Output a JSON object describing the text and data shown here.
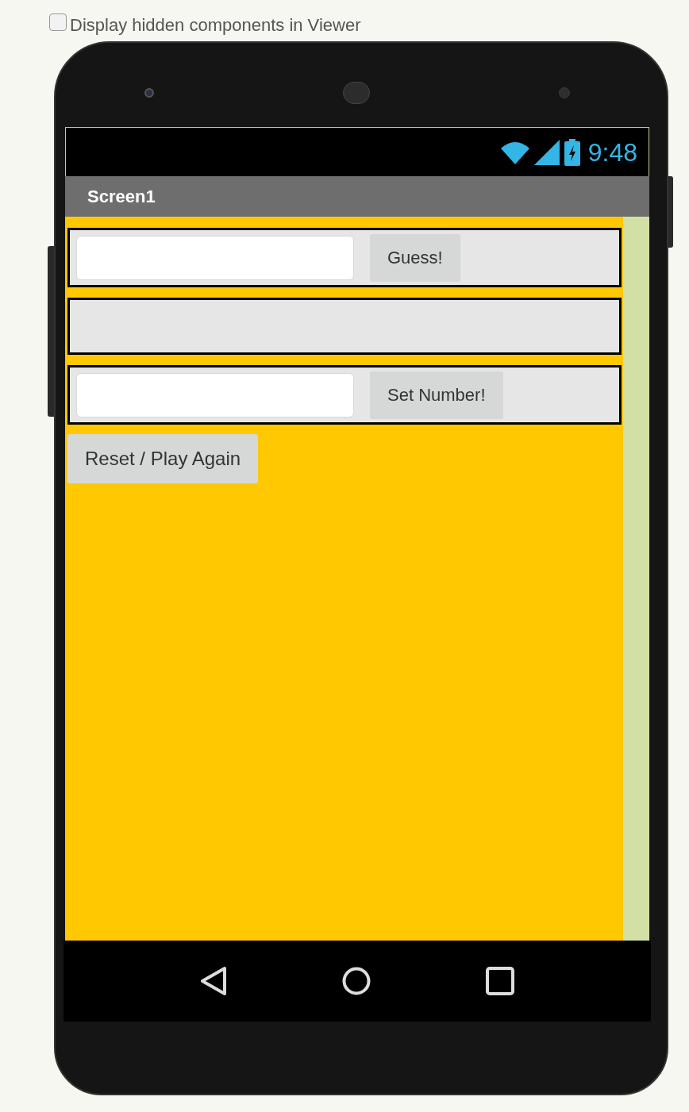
{
  "hidden_components_checkbox": {
    "label": "Display hidden components in Viewer",
    "checked": false
  },
  "status_bar": {
    "time": "9:48"
  },
  "screen": {
    "title": "Screen1"
  },
  "arrangements": [
    {
      "kind": "input_with_button",
      "button": "Guess!"
    },
    {
      "kind": "empty"
    },
    {
      "kind": "input_with_button",
      "button": "Set Number!"
    }
  ],
  "reset_button": "Reset / Play Again"
}
